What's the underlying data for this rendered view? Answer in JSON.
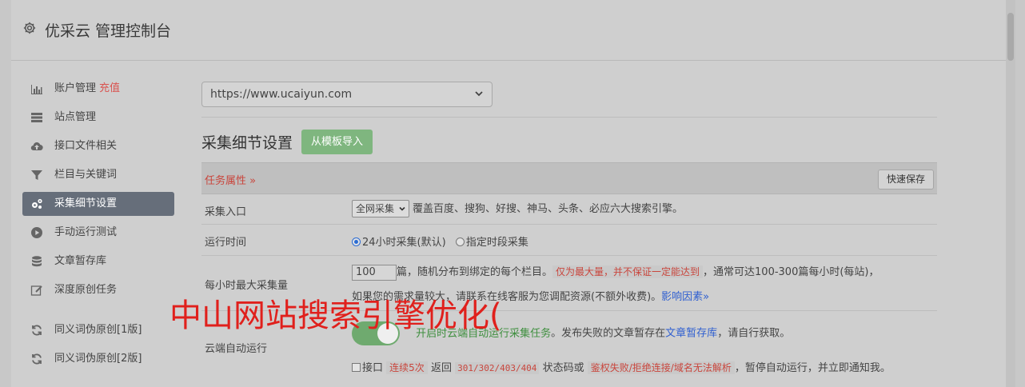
{
  "header": {
    "title": "优采云 管理控制台",
    "icon": "gear-icon"
  },
  "sidebar": {
    "items": [
      {
        "label": "账户管理",
        "extra": "充值",
        "icon": "bar-chart-icon"
      },
      {
        "label": "站点管理",
        "icon": "server-icon"
      },
      {
        "label": "接口文件相关",
        "icon": "cloud-upload-icon"
      },
      {
        "label": "栏目与关键词",
        "icon": "filter-icon"
      },
      {
        "label": "采集细节设置",
        "icon": "cogs-icon",
        "active": true
      },
      {
        "label": "手动运行测试",
        "icon": "play-circle-icon"
      },
      {
        "label": "文章暂存库",
        "icon": "database-icon"
      },
      {
        "label": "深度原创任务",
        "icon": "edit-icon"
      },
      {
        "label": "同义词伪原创[1版]",
        "icon": "refresh-icon"
      },
      {
        "label": "同义词伪原创[2版]",
        "icon": "refresh-icon"
      }
    ]
  },
  "main": {
    "site_select": "https://www.ucaiyun.com",
    "section_title": "采集细节设置",
    "import_button": "从模板导入",
    "table_header": {
      "label": "任务属性 »",
      "save_button": "快速保存"
    },
    "rows": {
      "entry": {
        "key": "采集入口",
        "select": "全网采集",
        "desc": "覆盖百度、搜狗、好搜、神马、头条、必应六大搜索引擎。"
      },
      "time": {
        "key": "运行时间",
        "opt1": "24小时采集(默认)",
        "opt2": "指定时段采集"
      },
      "max": {
        "key": "每小时最大采集量",
        "value": "100",
        "line1a": "篇，随机分布到绑定的每个栏目。",
        "line1b": "仅为最大量，并不保证一定能达到",
        "line1c": "，通常可达100-300篇每小时(每站)，",
        "line2a": "如果您的需求量较大，请联系在线客服为您调配资源(不额外收费)。",
        "line2b": "影响因素»"
      },
      "cloud": {
        "key": "云端自动运行",
        "toggle_on": true,
        "desc_green": "开启时云端自动运行采集任务",
        "desc_mid": "。发布失败的文章暂存在",
        "desc_link": "文章暂存库",
        "desc_end": "，请自行获取。",
        "chk_label": "接口",
        "chk_red1": "连续5次",
        "chk_mid1": "返回",
        "chk_code": "301/302/403/404",
        "chk_mid2": "状态码或",
        "chk_red2": "鉴权失败/拒绝连接/域名无法解析",
        "chk_end": "，暂停自动运行，并立即通知我。"
      }
    }
  },
  "overlay_text": "中山网站搜索引擎优化(",
  "colors": {
    "active_bg": "#666e7a",
    "green_btn": "#7fb67f",
    "red_text": "#c9463d",
    "link": "#2f5fd0",
    "overlay": "#e0201c"
  }
}
